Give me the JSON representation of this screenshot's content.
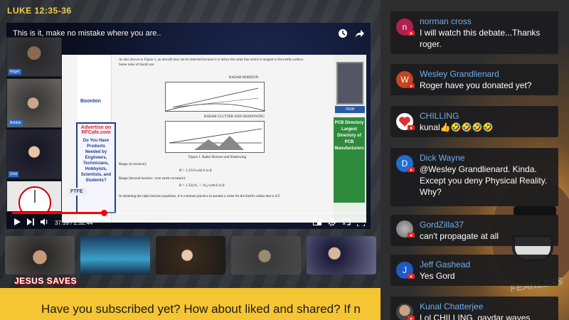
{
  "overlay": {
    "verse": "LUKE 12:35-36",
    "banner": "JESUS SAVES",
    "ticker": "Have you subscribed yet? How about liked and shared? If n"
  },
  "player": {
    "title": "This is it, make no mistake where you are..",
    "time": "37:39 / 2:32:44",
    "progress_fraction": 0.26,
    "ftfe": "FTFE",
    "doc_caption": "Figure 1. Radar Horizon and Shadowing",
    "doc_fig_top": "RADAR HORIZON",
    "doc_fig_bottom": "RADAR CLUTTER AND SHADOWING",
    "doc_ad_logo": "Boonton",
    "doc_ad_head": "Advertise on RFCafe.com",
    "doc_ad_body": "Do You Have Products Needed by Engineers, Technicians, Hobbyists, Scientists, and Students?",
    "doc_pcb": "PCB Directory Largest Directory of PCB Manufacturers",
    "doc_viewp": "VIEW PRODUCTS",
    "doc_text_1": "As also shown in Figure 1, an aircraft may not be detected because it is below the radar line which is tangent to the earths surface.",
    "doc_text_2": "Some rules of thumb are:",
    "doc_range1": "Range (to horizon):",
    "doc_range2": "Range (beyond horizon / over earth curvature):",
    "doc_footer": "In obtaining the radar horizon equations, it is common practice to assume a value for the Earth's radius that is 4/3"
  },
  "chat": [
    {
      "name": "norman cross",
      "message": "I will watch this debate...Thanks roger.",
      "initial": "n",
      "color": "#b0204f"
    },
    {
      "name": "Wesley Grandlienard",
      "message": "Roger have you donated yet?",
      "initial": "W",
      "color": "#c2461f"
    },
    {
      "name": "CHILLING",
      "message": "kunal👍🤣🤣🤣🤣",
      "initial": "",
      "color": "#ffffff"
    },
    {
      "name": "Dick Wayne",
      "message": "@Wesley Grandlienard. Kinda. Except you deny Physical Reality. Why?",
      "initial": "D",
      "color": "#1f6fd0"
    },
    {
      "name": "GordZilla37",
      "message": "can't propagate at all",
      "initial": "",
      "color": "#9aa0a6"
    },
    {
      "name": "Jeff Gashead",
      "message": "Yes Gord",
      "initial": "J",
      "color": "#1f5bc4"
    },
    {
      "name": "Kunal Chatterjee",
      "message": "Lol CHILLING, gaydar waves",
      "initial": "",
      "color": "#b58a66"
    }
  ],
  "icons": [
    "clock-icon",
    "share-icon",
    "play-icon",
    "next-icon",
    "volume-icon",
    "settings-icon",
    "cast-icon",
    "fullscreen-icon",
    "youtube-icon"
  ],
  "background_fearless": "FEARLESS"
}
